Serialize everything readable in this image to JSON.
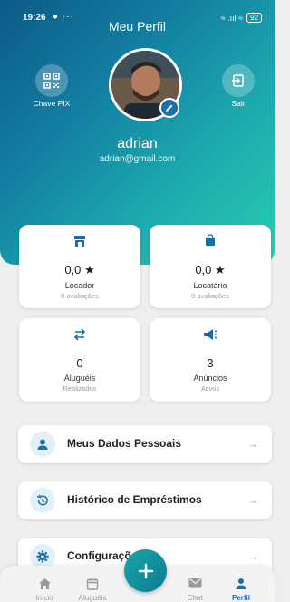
{
  "status_bar": {
    "time": "19:26",
    "dots": "● ···",
    "signal": "≈ .ııl ≈",
    "battery": "92"
  },
  "header": {
    "title": "Meu Perfil",
    "pix_label": "Chave PIX",
    "logout_label": "Sair",
    "user_name": "adrian",
    "user_email": "adrian@gmail.com"
  },
  "stats": [
    {
      "value": "0,0 ★",
      "label": "Locador",
      "sub": "0 avaliações"
    },
    {
      "value": "0,0 ★",
      "label": "Locatário",
      "sub": "0 avaliações"
    },
    {
      "value": "0",
      "label": "Aluguéis",
      "sub": "Realizados"
    },
    {
      "value": "3",
      "label": "Anúncios",
      "sub": "Ativos"
    }
  ],
  "menu": [
    {
      "label": "Meus Dados Pessoais",
      "icon": "person-icon"
    },
    {
      "label": "Histórico de Empréstimos",
      "icon": "history-icon"
    },
    {
      "label": "Configurações",
      "icon": "gear-icon"
    }
  ],
  "menu_arrow": "→",
  "nav": [
    {
      "label": "Início",
      "icon": "home-icon"
    },
    {
      "label": "Aluguéis",
      "icon": "calendar-icon"
    },
    {
      "label": "Chat",
      "icon": "mail-icon"
    },
    {
      "label": "Perfil",
      "icon": "person-icon",
      "active": true
    }
  ],
  "fab_label": "+",
  "colors": {
    "primary": "#1a6fa8",
    "header_start": "#0c5a86",
    "header_end": "#28cdb0",
    "accent": "#1a6fa8"
  }
}
